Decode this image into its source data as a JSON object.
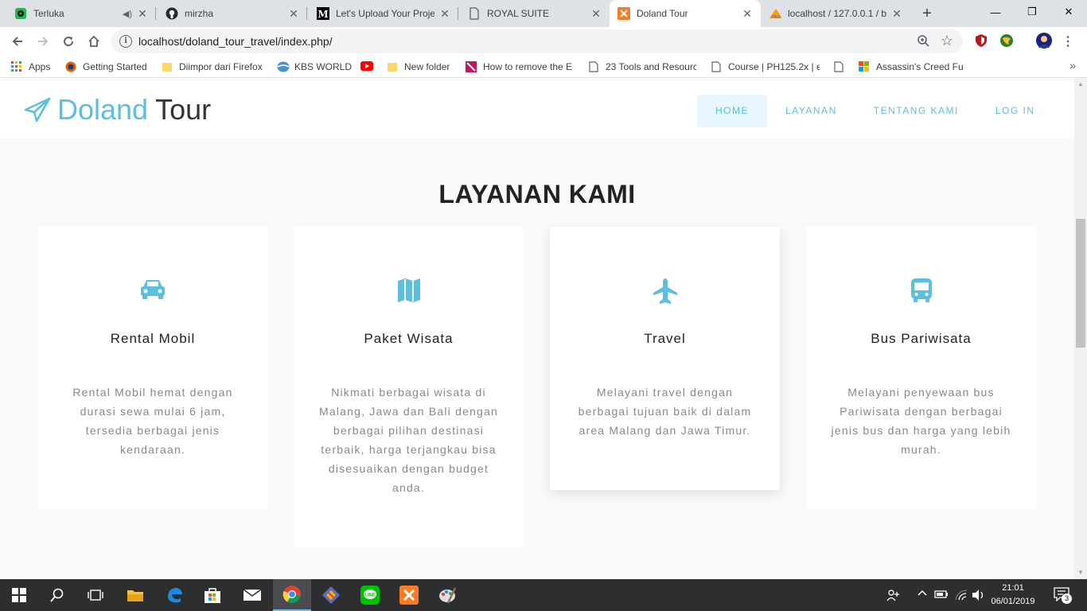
{
  "browser": {
    "tabs": [
      {
        "title": "Terluka"
      },
      {
        "title": "mirzha"
      },
      {
        "title": "Let's Upload Your Proje"
      },
      {
        "title": "ROYAL SUITE"
      },
      {
        "title": "Doland Tour"
      },
      {
        "title": "localhost / 127.0.0.1 / b"
      }
    ],
    "url": "localhost/doland_tour_travel/index.php/",
    "bookmarks": [
      {
        "label": "Apps"
      },
      {
        "label": "Getting Started"
      },
      {
        "label": "Diimpor dari Firefox"
      },
      {
        "label": "KBS WORLD"
      },
      {
        "label": "New folder"
      },
      {
        "label": "How to remove the E"
      },
      {
        "label": "23 Tools and Resourc"
      },
      {
        "label": "Course | PH125.2x | e"
      },
      {
        "label": "Assassin's Creed Full"
      }
    ]
  },
  "site": {
    "brand": {
      "part1": "Doland",
      "part2": "Tour"
    },
    "nav": [
      {
        "label": "HOME",
        "active": true
      },
      {
        "label": "LAYANAN"
      },
      {
        "label": "TENTANG KAMI"
      },
      {
        "label": "LOG IN"
      }
    ],
    "section_title": "LAYANAN KAMI",
    "services": [
      {
        "icon": "car-icon",
        "title": "Rental Mobil",
        "description": "Rental Mobil hemat dengan durasi sewa mulai 6 jam, tersedia berbagai jenis kendaraan."
      },
      {
        "icon": "map-icon",
        "title": "Paket Wisata",
        "description": "Nikmati berbagai wisata di Malang, Jawa dan Bali dengan berbagai pilihan destinasi terbaik, harga terjangkau bisa disesuaikan dengan budget anda."
      },
      {
        "icon": "plane-icon",
        "title": "Travel",
        "description": "Melayani travel dengan berbagai tujuan baik di dalam area Malang dan Jawa Timur."
      },
      {
        "icon": "bus-icon",
        "title": "Bus Pariwisata",
        "description": "Melayani penyewaan bus Pariwisata dengan berbagai jenis bus dan harga yang lebih murah."
      }
    ],
    "accent_color": "#5bc0de"
  },
  "taskbar": {
    "time": "21:01",
    "date": "06/01/2019",
    "notification_count": "3"
  }
}
